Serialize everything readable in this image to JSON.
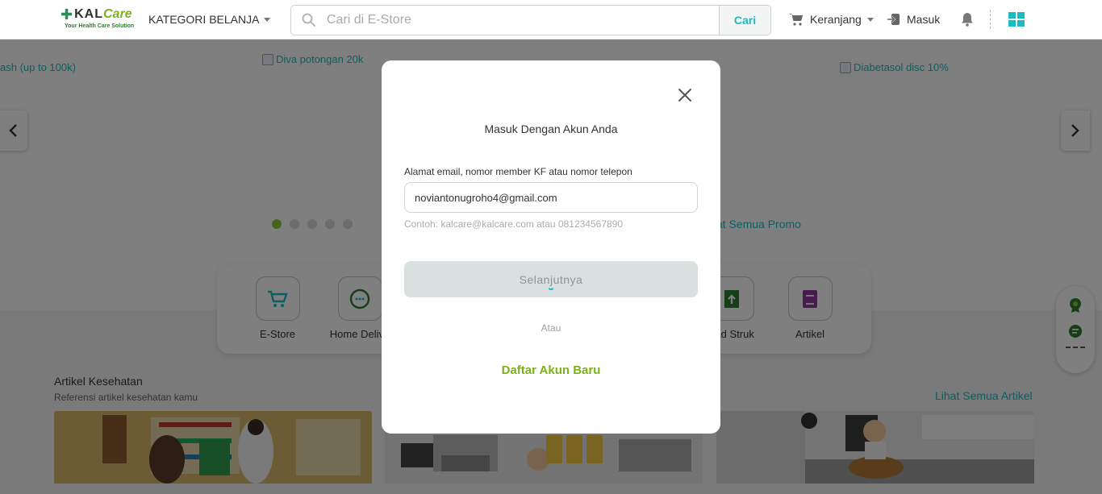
{
  "header": {
    "logo": {
      "main": "KALCare",
      "tagline": "Your Health Care Solution"
    },
    "kategori_label": "KATEGORI BELANJA",
    "search": {
      "placeholder": "Cari di E-Store",
      "button_label": "Cari"
    },
    "cart_label": "Keranjang",
    "login_label": "Masuk"
  },
  "banner": {
    "slide_alts": [
      "ash (up to 100k)",
      "Diva potongan 20k",
      "Diabetasol disc 10%"
    ],
    "dots_count": 5,
    "active_dot": 1,
    "promo_link": "ihat Semua Promo"
  },
  "services": [
    {
      "label": "E-Store",
      "icon": "cart-icon"
    },
    {
      "label": "Home Delive",
      "icon": "phone-chat-icon"
    },
    {
      "label": "oad Struk",
      "icon": "receipt-icon"
    },
    {
      "label": "Artikel",
      "icon": "book-icon"
    }
  ],
  "articles": {
    "title": "Artikel Kesehatan",
    "subtitle": "Referensi artikel kesehatan kamu",
    "see_all": "Lihat Semua Artikel"
  },
  "modal": {
    "title": "Masuk Dengan Akun Anda",
    "field_label": "Alamat email, nomor member KF atau nomor telepon",
    "field_value": "noviantonugroho4@gmail.com",
    "hint": "Contoh: kalcare@kalcare.com atau 081234567890",
    "next_button": "Selanjutnya",
    "or_text": "Atau",
    "register_link": "Daftar Akun Baru"
  },
  "colors": {
    "accent_teal": "#19bcc0",
    "accent_green": "#7ab317",
    "overlay": "rgba(0,0,0,0.5)"
  }
}
